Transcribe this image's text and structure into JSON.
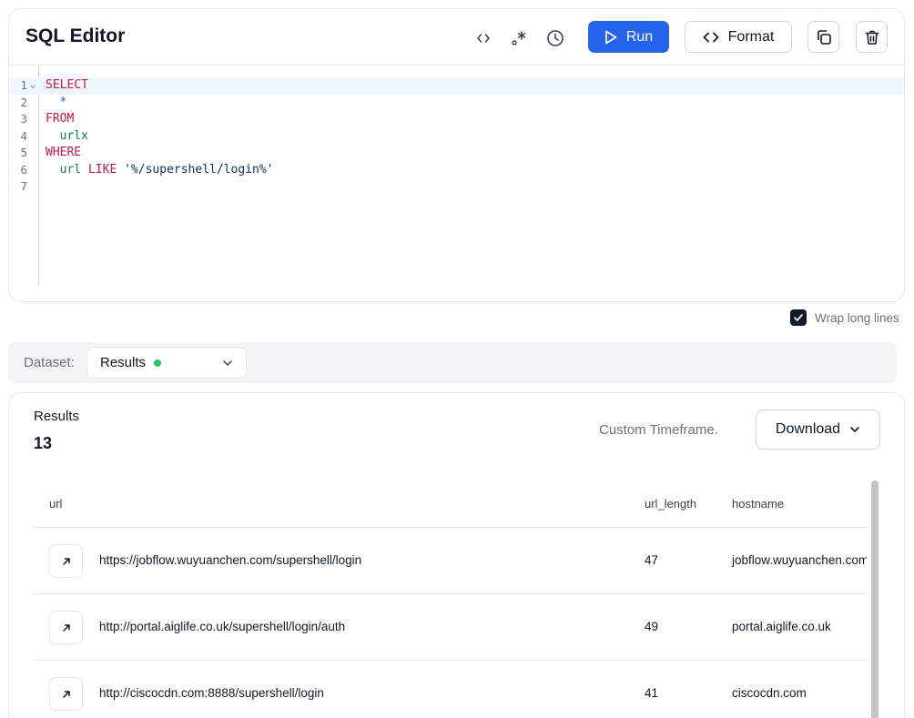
{
  "editor": {
    "title": "SQL Editor",
    "run_label": "Run",
    "format_label": "Format",
    "lines": [
      {
        "n": "1",
        "tokens": [
          {
            "t": "SELECT",
            "c": "kw"
          }
        ]
      },
      {
        "n": "2",
        "tokens": [
          {
            "t": "  ",
            "c": ""
          },
          {
            "t": "*",
            "c": "star"
          }
        ]
      },
      {
        "n": "3",
        "tokens": [
          {
            "t": "FROM",
            "c": "kw"
          }
        ]
      },
      {
        "n": "4",
        "tokens": [
          {
            "t": "  ",
            "c": ""
          },
          {
            "t": "urlx",
            "c": "ident"
          }
        ]
      },
      {
        "n": "5",
        "tokens": [
          {
            "t": "WHERE",
            "c": "kw"
          }
        ]
      },
      {
        "n": "6",
        "tokens": [
          {
            "t": "  ",
            "c": ""
          },
          {
            "t": "url",
            "c": "ident"
          },
          {
            "t": " ",
            "c": ""
          },
          {
            "t": "LIKE",
            "c": "kw"
          },
          {
            "t": " ",
            "c": ""
          },
          {
            "t": "'%/supershell/login%'",
            "c": "str"
          }
        ]
      },
      {
        "n": "7",
        "tokens": []
      }
    ]
  },
  "options": {
    "wrap_label": "Wrap long lines",
    "wrap_checked": true
  },
  "dataset": {
    "label": "Dataset:",
    "value": "Results",
    "status_color": "#22c55e"
  },
  "results": {
    "label": "Results",
    "count": "13",
    "timeframe": "Custom Timeframe.",
    "download_label": "Download",
    "columns": [
      "url",
      "url_length",
      "hostname"
    ],
    "rows": [
      {
        "url": "https://jobflow.wuyuanchen.com/supershell/login",
        "url_length": "47",
        "hostname": "jobflow.wuyuanchen.com"
      },
      {
        "url": "http://portal.aiglife.co.uk/supershell/login/auth",
        "url_length": "49",
        "hostname": "portal.aiglife.co.uk"
      },
      {
        "url": "http://ciscocdn.com:8888/supershell/login",
        "url_length": "41",
        "hostname": "ciscocdn.com"
      }
    ]
  },
  "colors": {
    "accent": "#2563eb",
    "keyword": "#c41a4a",
    "identifier": "#15803d",
    "string": "#0f2f5c"
  }
}
